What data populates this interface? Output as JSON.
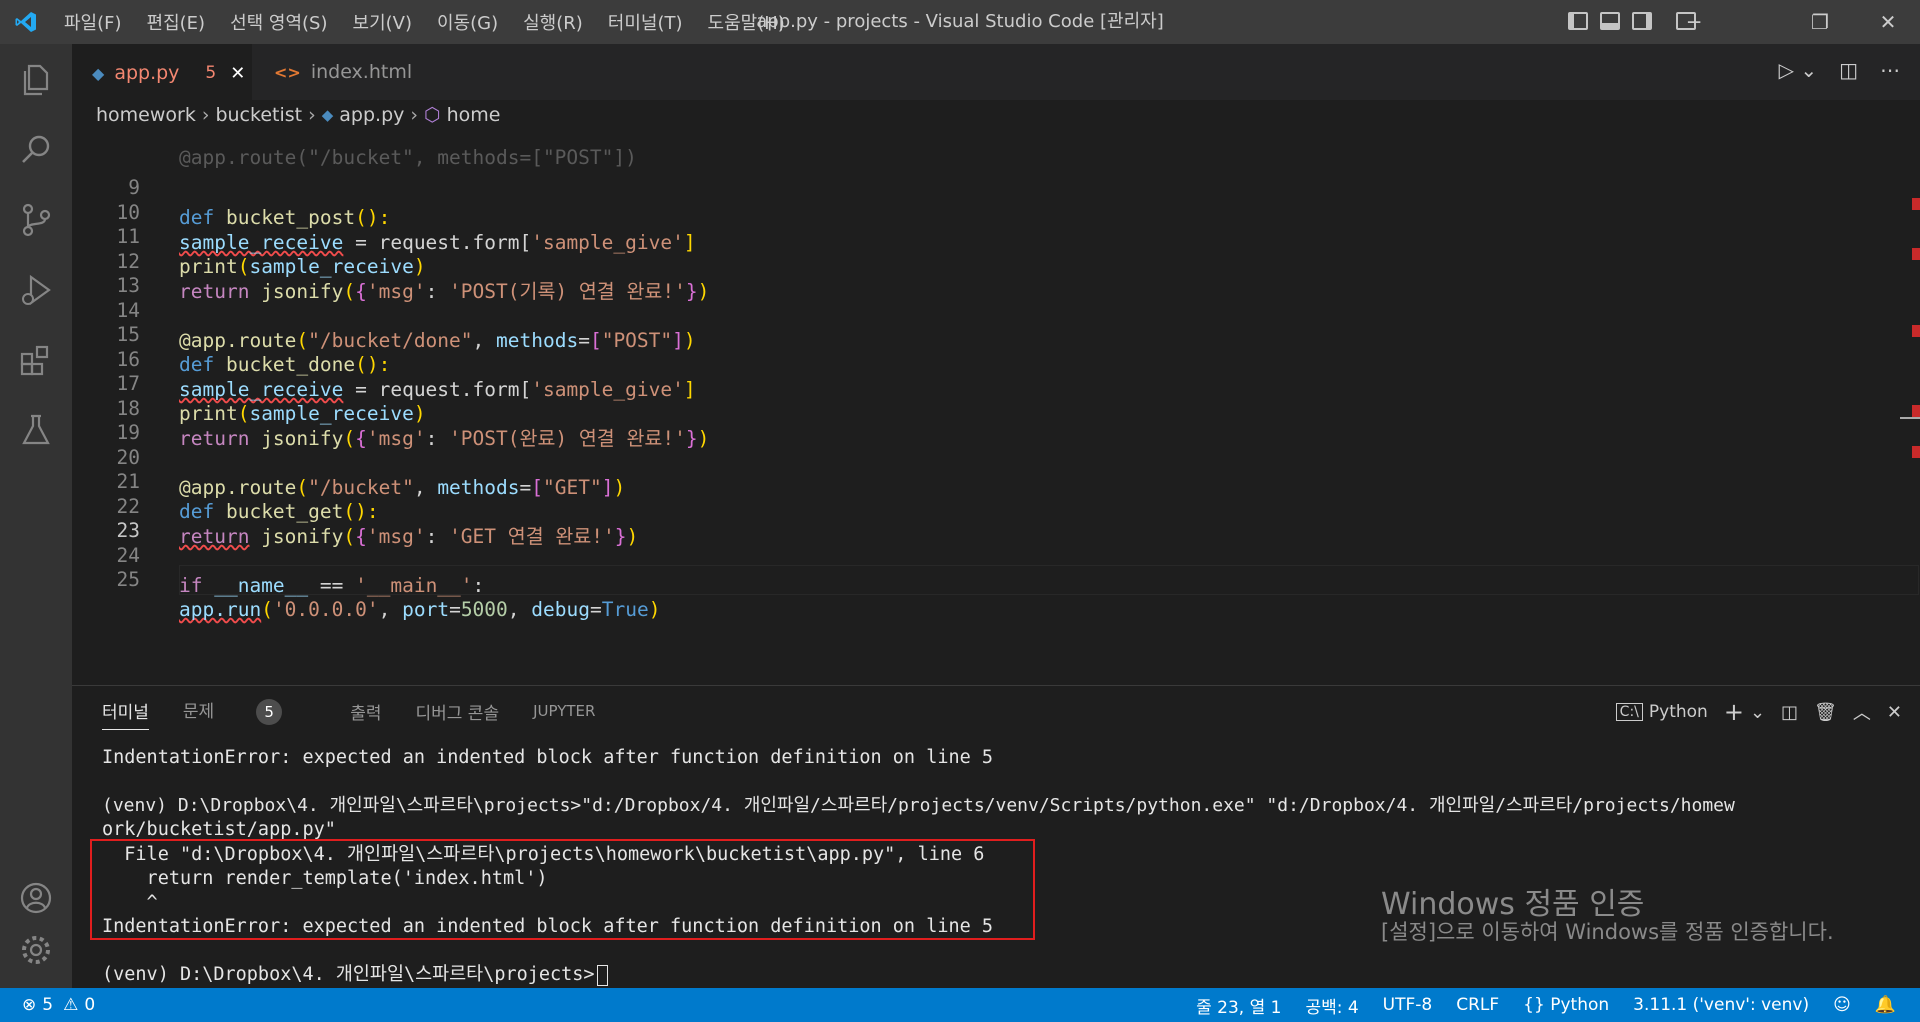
{
  "window": {
    "title": "app.py - projects - Visual Studio Code [관리자]",
    "menu": [
      "파일(F)",
      "편집(E)",
      "선택 영역(S)",
      "보기(V)",
      "이동(G)",
      "실행(R)",
      "터미널(T)",
      "도움말(H)"
    ]
  },
  "tabs": [
    {
      "label": "app.py",
      "problems": "5",
      "active": true
    },
    {
      "label": "index.html",
      "active": false
    }
  ],
  "breadcrumb": {
    "items": [
      "homework",
      "bucketist",
      "app.py",
      "home"
    ]
  },
  "editor": {
    "line_numbers": [
      "9",
      "10",
      "11",
      "12",
      "13",
      "14",
      "15",
      "16",
      "17",
      "18",
      "19",
      "20",
      "21",
      "22",
      "23",
      "24",
      "25"
    ],
    "partial_line": "@app.route(\"/bucket\", methods=[\"POST\"])",
    "t": {
      "def": "def ",
      "bucket_post": "bucket_post",
      "bucket_done": "bucket_done",
      "bucket_get": "bucket_get",
      "parens_colon": "():",
      "sample_receive": "sample_receive",
      "eq_request_form": " = request.form[",
      "sample_give": "'sample_give'",
      "rbr": "]",
      "print": "print",
      "lp": "(",
      "rp": ")",
      "return": "return",
      "jsonify": " jsonify",
      "lb": "{",
      "rb": "}",
      "msg": "'msg'",
      "colon": ": ",
      "post_record": "'POST(기록) 연결 완료!'",
      "post_done": "'POST(완료) 연결 완료!'",
      "get_done": "'GET 연결 완료!'",
      "at_route": "@app.route",
      "done_path": "\"/bucket/done\"",
      "bucket_path": "\"/bucket\"",
      "comma": ", ",
      "methods": "methods",
      "eq": "=",
      "lsq": "[",
      "rsq": "]",
      "post": "\"POST\"",
      "get": "\"GET\"",
      "if": "if",
      "name": " __name__ ",
      "eqeq": "== ",
      "main": "'__main__'",
      "colon_end": ":",
      "app_run": "app.run",
      "ip": "'0.0.0.0'",
      "port": "port",
      "port_val": "5000",
      "debug": "debug",
      "true": "True"
    }
  },
  "panel": {
    "tabs": [
      "터미널",
      "문제",
      "출력",
      "디버그 콘솔",
      "JUPYTER"
    ],
    "problems_count": "5",
    "shell": "Python",
    "terminal_lines": [
      "IndentationError: expected an indented block after function definition on line 5",
      "",
      "(venv) D:\\Dropbox\\4. 개인파일\\스파르타\\projects>\"d:/Dropbox/4. 개인파일/스파르타/projects/venv/Scripts/python.exe\" \"d:/Dropbox/4. 개인파일/스파르타/projects/homew",
      "ork/bucketist/app.py\"",
      "  File \"d:\\Dropbox\\4. 개인파일\\스파르타\\projects\\homework\\bucketist\\app.py\", line 6",
      "    return render_template('index.html')",
      "    ^",
      "IndentationError: expected an indented block after function definition on line 5",
      "",
      "(venv) D:\\Dropbox\\4. 개인파일\\스파르타\\projects>"
    ]
  },
  "watermark": {
    "title": "Windows 정품 인증",
    "body": "[설정]으로 이동하여 Windows를 정품 인증합니다."
  },
  "statusbar": {
    "errors": "5",
    "warnings": "0",
    "position": "줄 23, 열 1",
    "spaces": "공백: 4",
    "encoding": "UTF-8",
    "eol": "CRLF",
    "language": "Python",
    "interpreter": "3.11.1 ('venv': venv)"
  },
  "colors": {
    "statusbar": "#007acc",
    "error_box": "#e01e1e",
    "activity_bar": "#333333"
  }
}
